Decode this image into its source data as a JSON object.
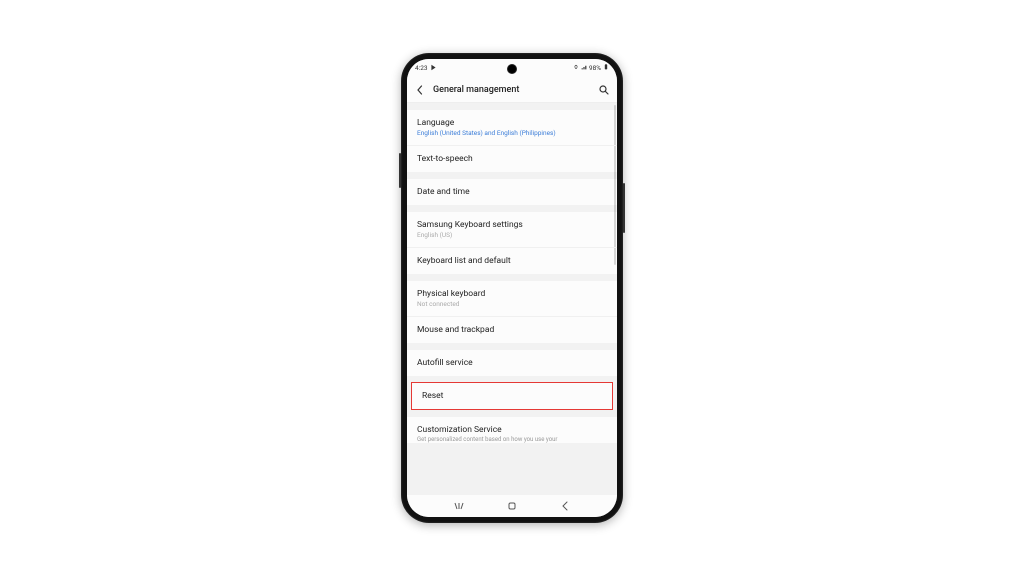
{
  "status": {
    "time": "4:23",
    "battery_text": "98%"
  },
  "header": {
    "title": "General management"
  },
  "groups": [
    {
      "items": [
        {
          "title": "Language",
          "sub": "English (United States) and English (Philippines)",
          "sub_color": "blue"
        },
        {
          "title": "Text-to-speech"
        }
      ]
    },
    {
      "items": [
        {
          "title": "Date and time"
        }
      ]
    },
    {
      "items": [
        {
          "title": "Samsung Keyboard settings",
          "sub": "English (US)"
        },
        {
          "title": "Keyboard list and default"
        }
      ]
    },
    {
      "items": [
        {
          "title": "Physical keyboard",
          "sub": "Not connected"
        },
        {
          "title": "Mouse and trackpad"
        }
      ]
    },
    {
      "items": [
        {
          "title": "Autofill service"
        }
      ]
    }
  ],
  "highlighted": {
    "title": "Reset"
  },
  "cutoff": {
    "title": "Customization Service",
    "sub": "Get personalized content based on how you use your"
  }
}
